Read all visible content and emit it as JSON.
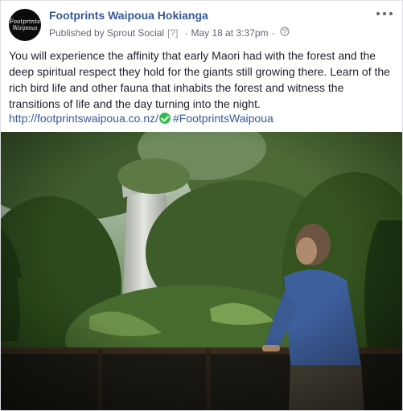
{
  "post": {
    "avatar": {
      "line1": "Footprints",
      "line2": "Waipoua"
    },
    "page_name": "Footprints Waipoua Hokianga",
    "meta": {
      "published_by": "Published by",
      "app": "Sprout Social",
      "help": "[?]",
      "separator": "·",
      "date": "May 18 at 3:37pm",
      "separator2": "·"
    },
    "text": "You will experience the affinity that early Maori had with the forest and the deep spiritual respect they hold for the giants still growing there. Learn of the rich bird life and other fauna that inhabits the forest and witness the transitions of life and the day turning into the night.",
    "link": "http://footprintswaipoua.co.nz/",
    "hashtag": "#FootprintsWaipoua",
    "icons": {
      "more": "more-options-icon",
      "privacy": "globe-icon",
      "verified": "check-circle-icon"
    }
  }
}
